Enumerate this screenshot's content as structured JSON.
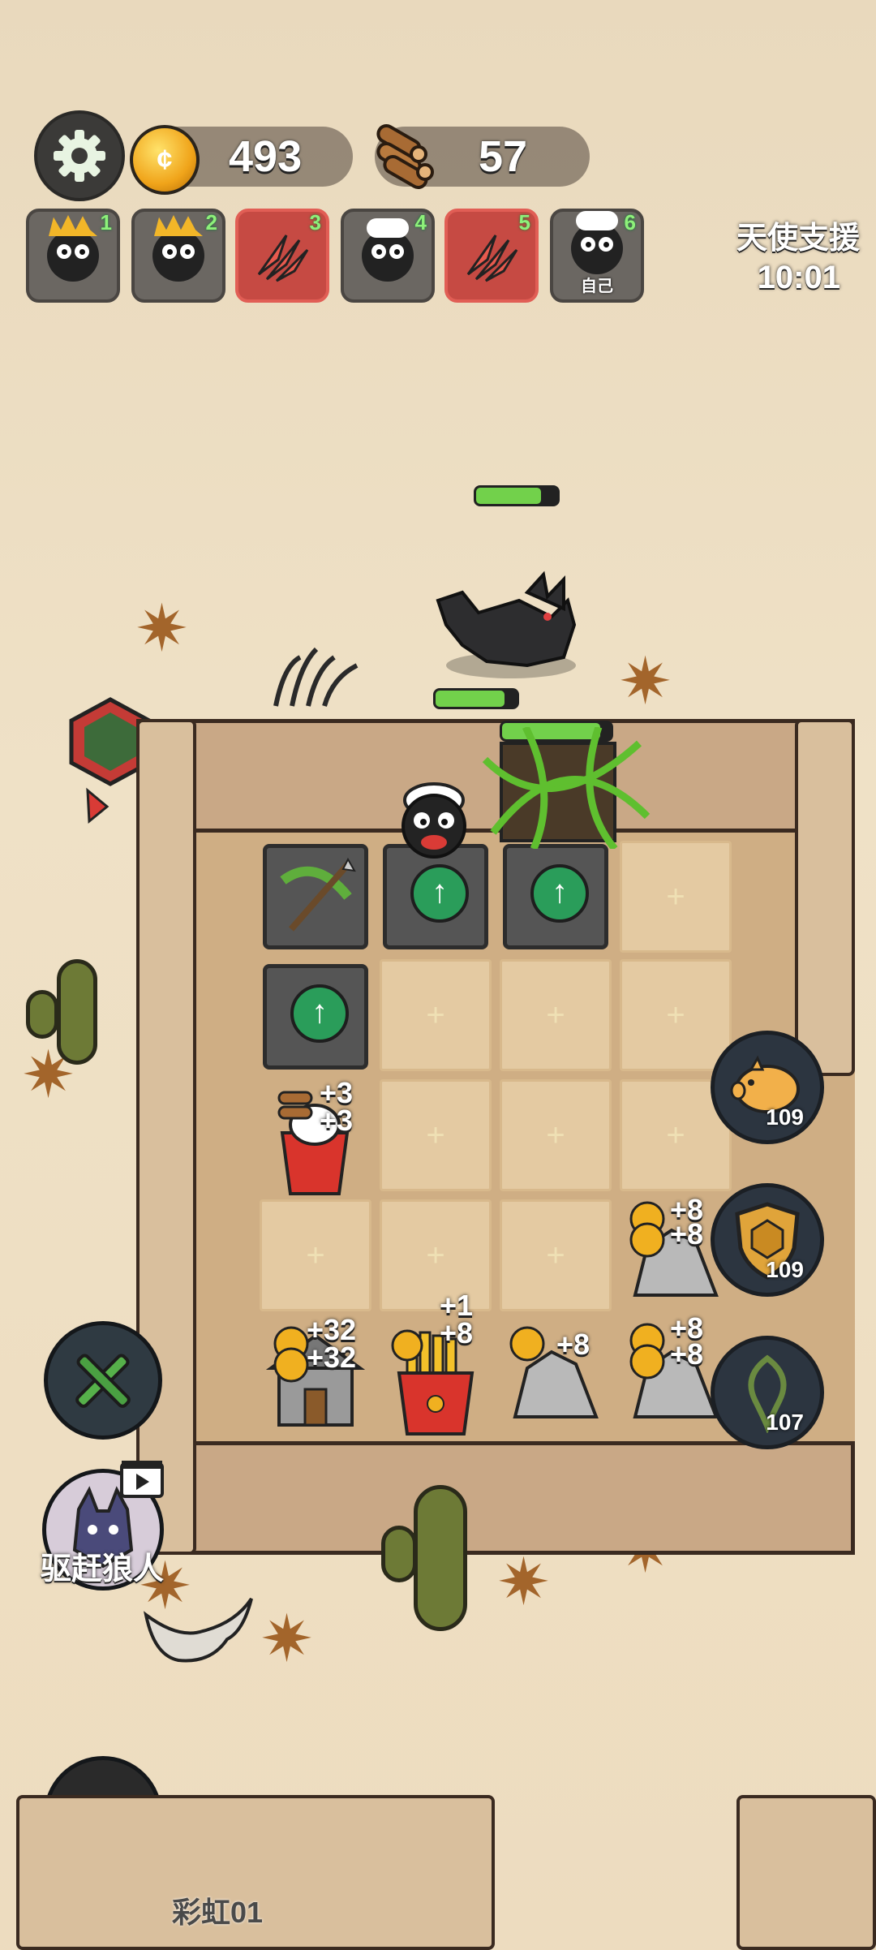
{
  "top_bar": {
    "coins": "493",
    "wood": "57"
  },
  "players": [
    {
      "num": "1",
      "type": "spiky-sheep",
      "alert": false,
      "label": ""
    },
    {
      "num": "2",
      "type": "spiky-sheep",
      "alert": false,
      "label": ""
    },
    {
      "num": "3",
      "type": "claw",
      "alert": true,
      "label": ""
    },
    {
      "num": "4",
      "type": "fluffy-sheep",
      "alert": false,
      "label": ""
    },
    {
      "num": "5",
      "type": "claw",
      "alert": true,
      "label": ""
    },
    {
      "num": "6",
      "type": "fluffy-sheep",
      "alert": false,
      "label": "自己"
    }
  ],
  "angel_support": {
    "title": "天使支援",
    "time": "10:01"
  },
  "board": {
    "tile_plus": "+",
    "floating": {
      "wood_left_1": "+3",
      "wood_left_2": "+3",
      "house_1": "+32",
      "house_2": "+32",
      "fries_1": "+1",
      "fries_2": "+8",
      "rock_1": "+8",
      "rock_2a": "+8",
      "rock_2b": "+8",
      "rock_3a": "+8",
      "rock_3b": "+8"
    }
  },
  "health": {
    "wolf": 0.8,
    "sheep": 0.85,
    "thorn": 0.9
  },
  "side_buttons": {
    "piggy_bank": "109",
    "shield": "109",
    "thorns": "107"
  },
  "actions": {
    "repel_wolf_label": "驱赶狼人"
  },
  "other_player": {
    "name": "彩虹01"
  },
  "colors": {
    "accent_green": "#2a9d5a",
    "alert_red": "#c64a43",
    "health_green": "#72d14b"
  }
}
